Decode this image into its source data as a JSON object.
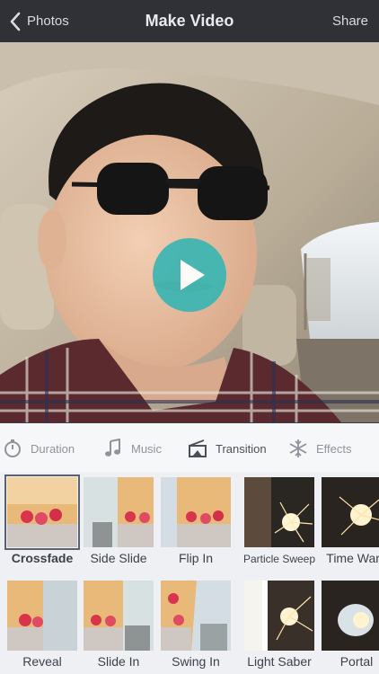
{
  "nav": {
    "back_label": "Photos",
    "title": "Make Video",
    "share_label": "Share"
  },
  "player": {
    "play_icon": "play-icon"
  },
  "tabs": [
    {
      "label": "Duration",
      "icon": "stopwatch-icon"
    },
    {
      "label": "Music",
      "icon": "music-note-icon"
    },
    {
      "label": "Transition",
      "icon": "transition-icon",
      "active": true
    },
    {
      "label": "Effects",
      "icon": "snowflake-icon"
    }
  ],
  "transitions": {
    "row1": [
      "Crossfade",
      "Side Slide",
      "Flip In",
      "Particle Sweep",
      "Time Warp"
    ],
    "row2": [
      "Reveal",
      "Slide In",
      "Swing In",
      "Light Saber",
      "Portal"
    ],
    "selected": "Crossfade"
  },
  "colors": {
    "nav_bg": "#2f3137",
    "play_button": "#3cb5b2",
    "tab_active": "#4a4f5a",
    "tab_inactive": "#8f939b"
  }
}
